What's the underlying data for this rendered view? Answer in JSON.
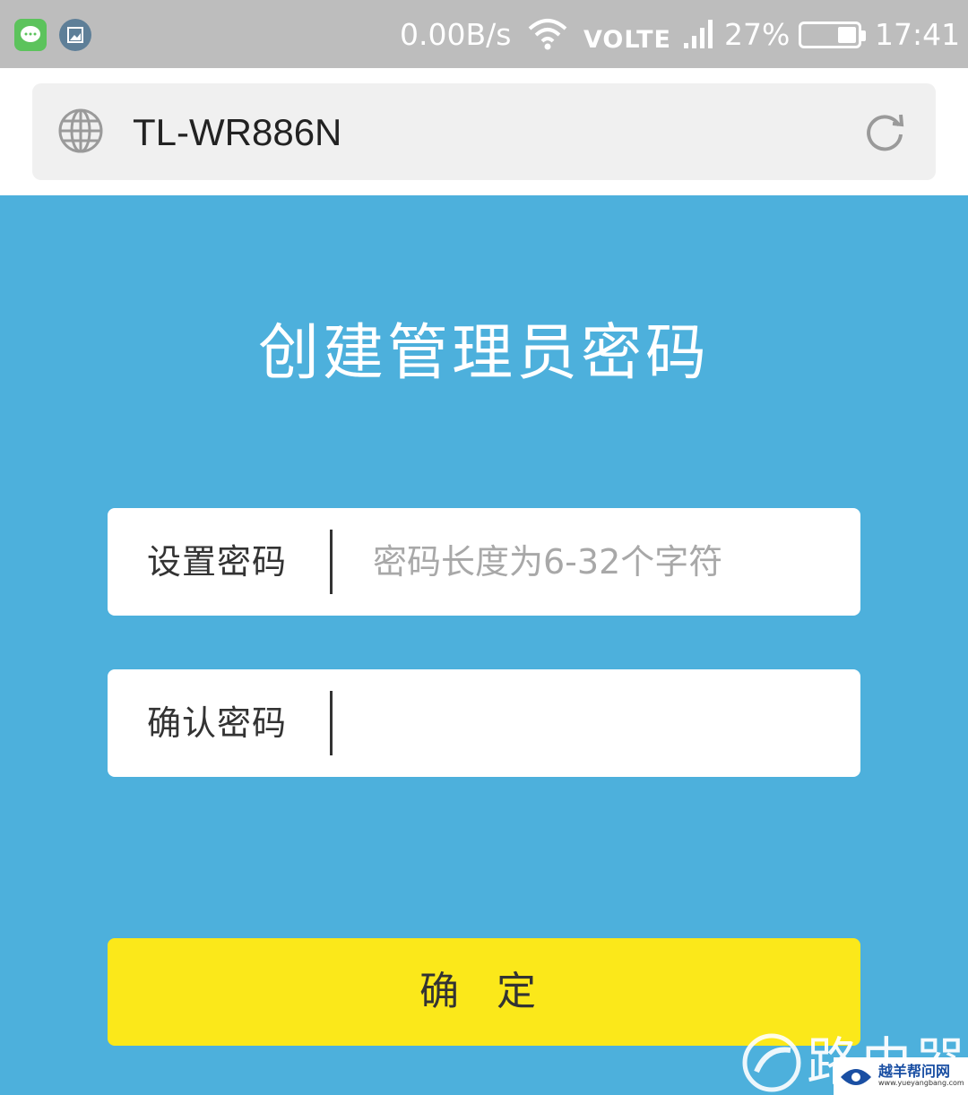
{
  "status_bar": {
    "network_speed": "0.00B/s",
    "volte": "VOLTE",
    "battery_percent": "27%",
    "time": "17:41",
    "icons": [
      "message-app-icon",
      "gallery-app-icon",
      "wifi-icon",
      "signal-icon",
      "battery-icon"
    ]
  },
  "browser": {
    "url": "TL-WR886N",
    "icons": [
      "globe-icon",
      "reload-icon"
    ]
  },
  "page": {
    "title": "创建管理员密码",
    "password_field": {
      "label": "设置密码",
      "placeholder": "密码长度为6-32个字符",
      "value": ""
    },
    "confirm_field": {
      "label": "确认密码",
      "placeholder": "",
      "value": ""
    },
    "confirm_button": "确 定"
  },
  "watermark": {
    "text": "路由器",
    "badge_title": "越羊帮问网",
    "badge_url": "www.yueyangbang.com"
  },
  "colors": {
    "background": "#4db0dc",
    "button": "#fbe81a",
    "status_bar": "#bdbdbd"
  }
}
